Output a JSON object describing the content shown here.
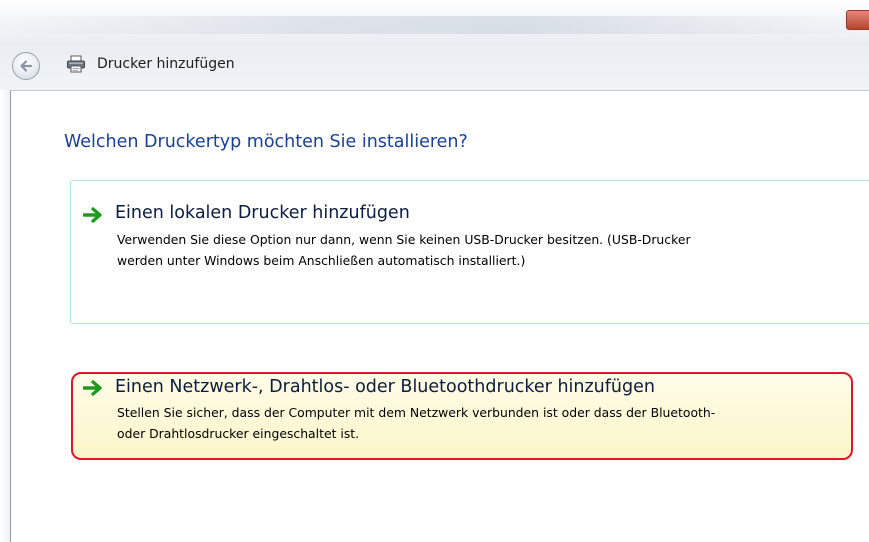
{
  "window": {
    "title": "Drucker hinzufügen",
    "back_icon": "back-arrow-icon",
    "title_icon": "printer-icon"
  },
  "main": {
    "heading": "Welchen Druckertyp möchten Sie installieren?",
    "options": [
      {
        "icon": "green-arrow-icon",
        "title": "Einen lokalen Drucker hinzufügen",
        "description_line1": "Verwenden Sie diese Option nur dann, wenn Sie keinen USB-Drucker besitzen. (USB-Drucker",
        "description_line2": "werden unter Windows beim Anschließen automatisch installiert.)"
      },
      {
        "icon": "green-arrow-icon",
        "title": "Einen Netzwerk-, Drahtlos- oder Bluetoothdrucker hinzufügen",
        "description_line1": "Stellen Sie sicher, dass der Computer mit dem Netzwerk verbunden ist oder dass der Bluetooth-",
        "description_line2": "oder Drahtlosdrucker eingeschaltet ist.",
        "highlighted": true
      }
    ]
  },
  "colors": {
    "heading": "#1a3f95",
    "highlight_border": "#e0142b",
    "highlight_fill": "#fbf6c9",
    "option_border": "#a7e4ee",
    "arrow_green": "#1e9a1e"
  }
}
